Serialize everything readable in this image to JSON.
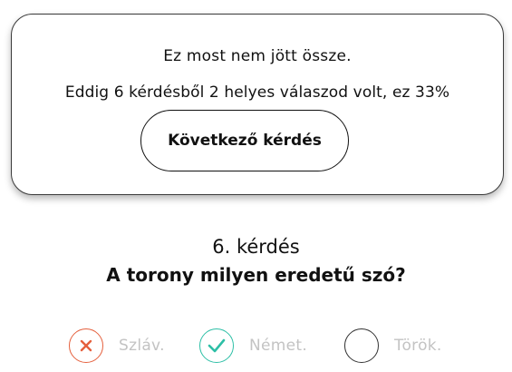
{
  "feedback": {
    "message": "Ez most nem jött össze.",
    "score_text": "Eddig 6 kérdésből 2 helyes válaszod volt, ez 33%",
    "next_button_label": "Következő kérdés"
  },
  "question": {
    "number_label": "6. kérdés",
    "text": "A torony milyen eredetű szó?"
  },
  "options": [
    {
      "label": "Szláv.",
      "state": "wrong",
      "icon": "x-icon",
      "color": "#e5603d"
    },
    {
      "label": "Német.",
      "state": "correct",
      "icon": "check-icon",
      "color": "#2dbfa6"
    },
    {
      "label": "Török.",
      "state": "neutral",
      "icon": "",
      "color": "#333333"
    }
  ]
}
